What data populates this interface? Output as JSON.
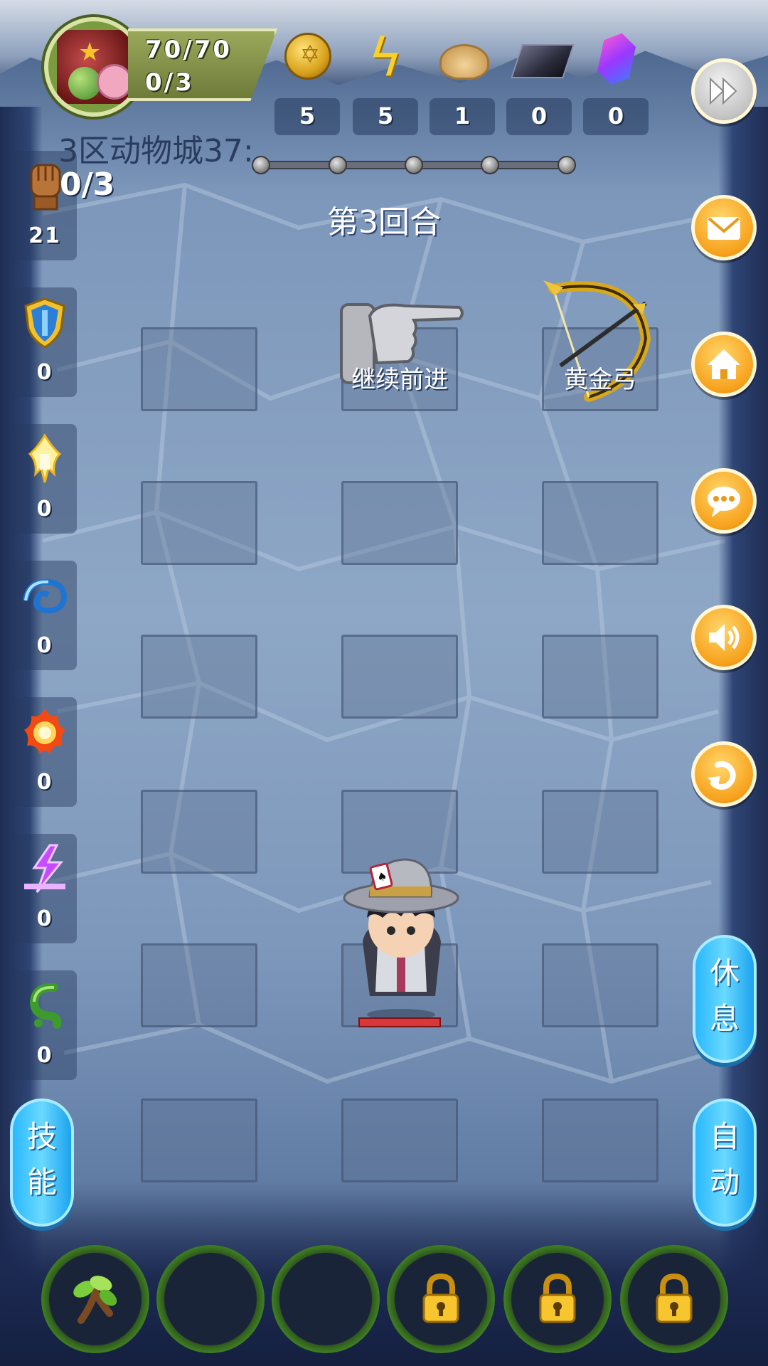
{
  "player": {
    "hp": "70/70",
    "level_progress": "0/3"
  },
  "resources": [
    {
      "name": "coin-icon",
      "value": "5"
    },
    {
      "name": "energy-icon",
      "value": "5"
    },
    {
      "name": "bun-icon",
      "value": "1"
    },
    {
      "name": "ingot-icon",
      "value": "0"
    },
    {
      "name": "gem-icon",
      "value": "0"
    }
  ],
  "level": {
    "name": "3区动物城37:",
    "progress": "0/3",
    "round": "第3回合"
  },
  "elements": [
    {
      "name": "fist-icon",
      "value": "21"
    },
    {
      "name": "shield-icon",
      "value": "0"
    },
    {
      "name": "light-icon",
      "value": "0"
    },
    {
      "name": "water-icon",
      "value": "0"
    },
    {
      "name": "fire-icon",
      "value": "0"
    },
    {
      "name": "lightning-icon",
      "value": "0"
    },
    {
      "name": "poison-icon",
      "value": "0"
    }
  ],
  "board": {
    "continue_label": "继续前进",
    "bow_label": "黄金弓"
  },
  "buttons": {
    "rest": "休息",
    "auto": "自动",
    "skill": "技能"
  },
  "colors": {
    "accent_orange": "#f7a11c",
    "pill_blue": "#2ab8ff",
    "hp_red": "#d9383a"
  }
}
